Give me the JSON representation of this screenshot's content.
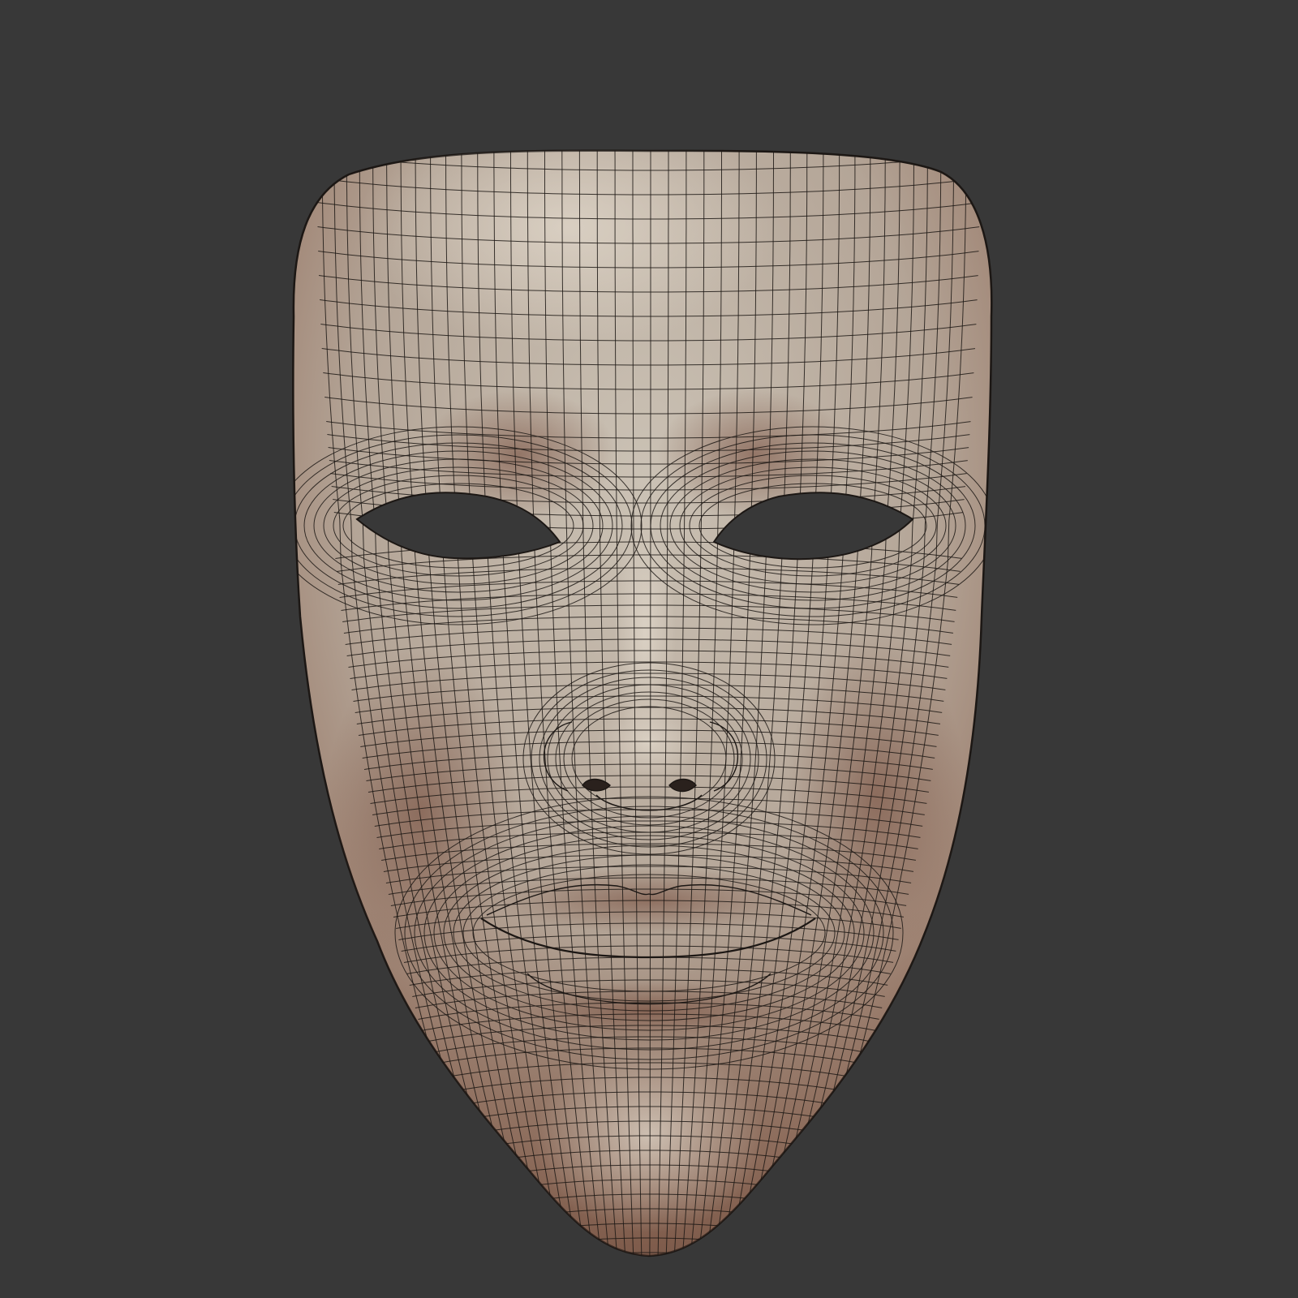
{
  "scene": {
    "subject": "face-mask-wireframe-render",
    "colors": {
      "background": "#383838",
      "surface_light": "#c9bfb2",
      "surface_mid": "#a8968a",
      "surface_shadow": "#7e5a48",
      "wire": "#1c1714",
      "hole": "#383838"
    }
  }
}
